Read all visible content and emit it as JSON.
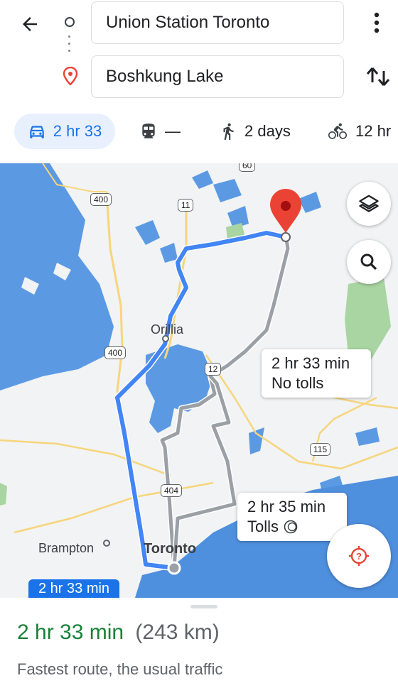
{
  "header": {
    "origin": "Union Station Toronto",
    "destination": "Boshkung Lake"
  },
  "modes": [
    {
      "icon": "car-icon",
      "label": "2 hr 33",
      "selected": true
    },
    {
      "icon": "transit-icon",
      "label": "—",
      "selected": false
    },
    {
      "icon": "walking-icon",
      "label": "2 days",
      "selected": false
    },
    {
      "icon": "bicycle-icon",
      "label": "12 hr",
      "selected": false
    }
  ],
  "map": {
    "routes": [
      {
        "label_line1": "2 hr 33 min",
        "label_line2": "No tolls"
      },
      {
        "label_line1": "2 hr 35 min",
        "label_line2": "Tolls"
      }
    ],
    "selected_route_label": "2 hr 33 min",
    "places": {
      "orillia": "Orillia",
      "brampton": "Brampton",
      "toronto": "Toronto"
    },
    "highways": [
      "400",
      "11",
      "400",
      "12",
      "115",
      "404",
      "60"
    ]
  },
  "summary": {
    "duration": "2 hr 33 min",
    "distance": "(243 km)",
    "description": "Fastest route, the usual traffic"
  },
  "colors": {
    "selected_route": "#4285f4",
    "alternate_route": "#9aa0a6",
    "water": "#4e8fde",
    "duration_green": "#188038",
    "destination_pin": "#ea4335"
  }
}
